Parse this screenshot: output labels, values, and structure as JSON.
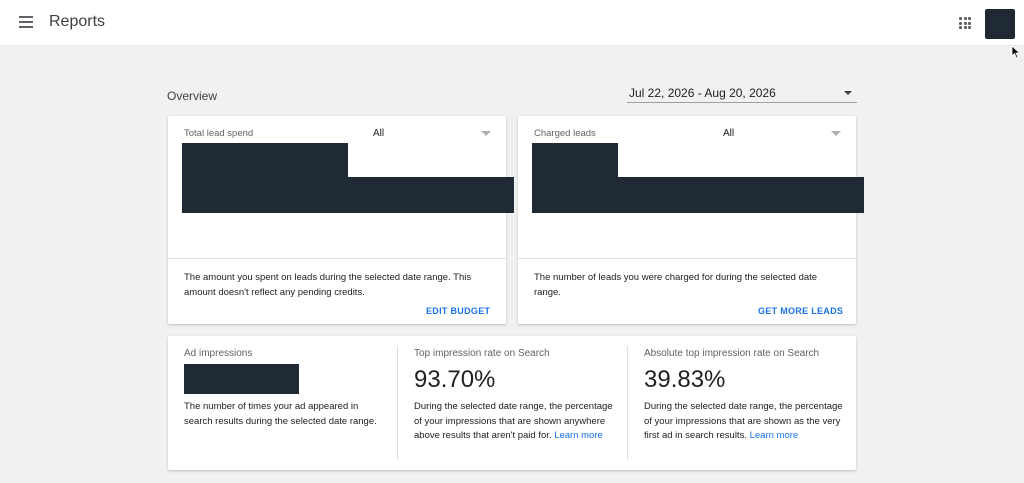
{
  "header": {
    "title": "Reports",
    "menu_icon": "hamburger-menu-icon",
    "apps_icon": "apps-grid-icon"
  },
  "overview": {
    "title": "Overview",
    "date_range": "Jul 22, 2026 - Aug 20, 2026"
  },
  "spend_card": {
    "label": "Total lead spend",
    "filter": "All",
    "description": "The amount you spent on leads during the selected date range. This amount doesn't reflect any pending credits.",
    "action": "EDIT BUDGET"
  },
  "leads_card": {
    "label": "Charged leads",
    "filter": "All",
    "description": "The number of leads you were charged for during the selected date range.",
    "action": "GET MORE LEADS"
  },
  "metrics": {
    "impressions": {
      "label": "Ad impressions",
      "description": "The number of times your ad appeared in search results during the selected date range."
    },
    "top_rate": {
      "label": "Top impression rate on Search",
      "value": "93.70%",
      "description": "During the selected date range, the percentage of your impressions that are shown anywhere above results that aren't paid for.",
      "link": "Learn more"
    },
    "abs_top_rate": {
      "label": "Absolute top impression rate on Search",
      "value": "39.83%",
      "description": "During the selected date range, the percentage of your impressions that are shown as the very first ad in search results.",
      "link": "Learn more"
    }
  },
  "colors": {
    "accent": "#1a73e8",
    "redaction": "#1f2a35",
    "background": "#f1f1f1"
  }
}
